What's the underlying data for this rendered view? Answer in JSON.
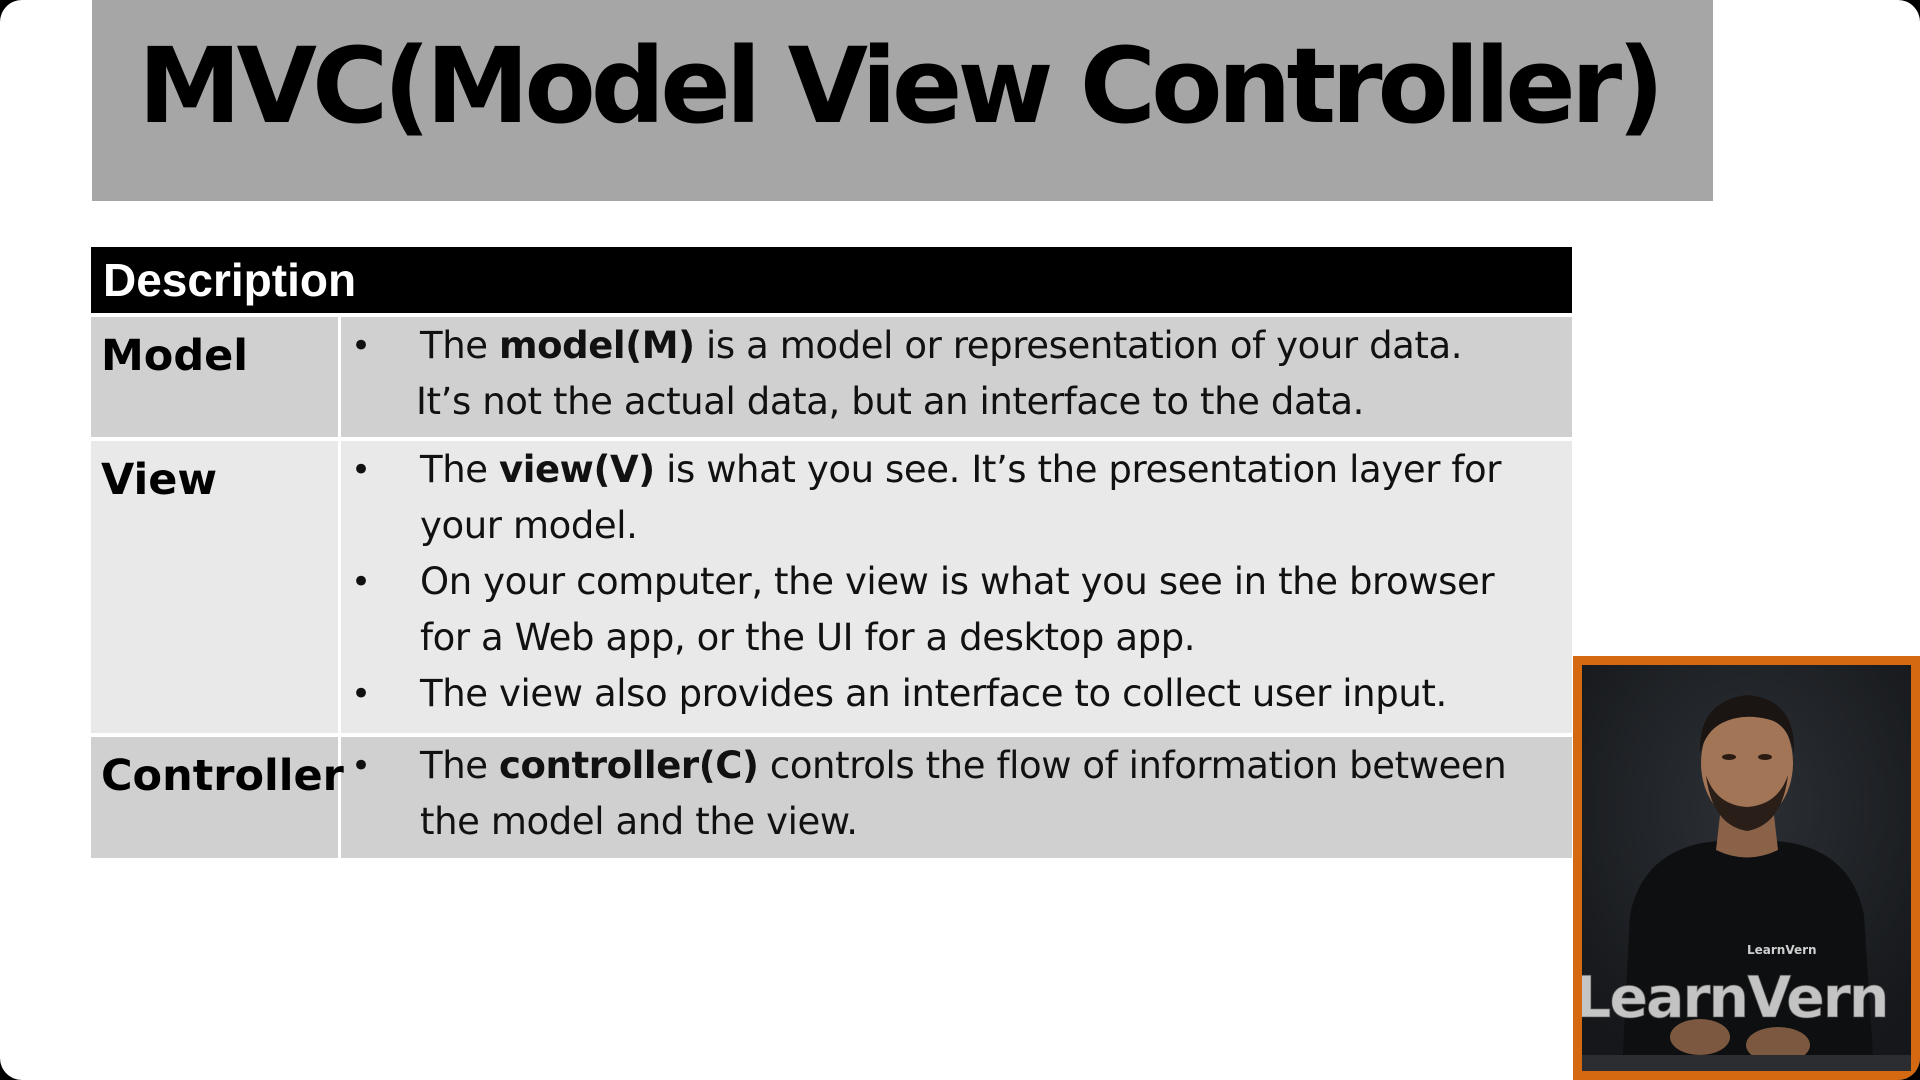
{
  "slide": {
    "title": "MVC(Model View Controller)"
  },
  "table": {
    "header": "Description",
    "rows": [
      {
        "term": "Model",
        "items": [
          {
            "pre": "The ",
            "bold": "model(M)",
            "post": " is a model or representation of your data.",
            "cont": "It’s not the actual data, but an interface to the data."
          }
        ]
      },
      {
        "term": "View",
        "items": [
          {
            "pre": "The ",
            "bold": "view(V)",
            "post": " is what you see. It’s the presentation layer for your model."
          },
          {
            "text": "On your computer, the view is what you see in the browser for a Web app, or the UI for a desktop app."
          },
          {
            "text": "The view also provides an interface to collect user input."
          }
        ]
      },
      {
        "term": "Controller",
        "items": [
          {
            "pre": "The ",
            "bold": "controller(C)",
            "post": " controls the flow of information between the model and the view."
          }
        ]
      }
    ],
    "bullet": "•"
  },
  "presenter": {
    "watermark": "LearnVern",
    "shirt_logo": "LearnVern"
  },
  "colors": {
    "title_band": "#a6a6a6",
    "header_bg": "#000000",
    "row_dark": "#d0d0d0",
    "row_light": "#e9e9e9",
    "presenter_border": "#d56912"
  }
}
